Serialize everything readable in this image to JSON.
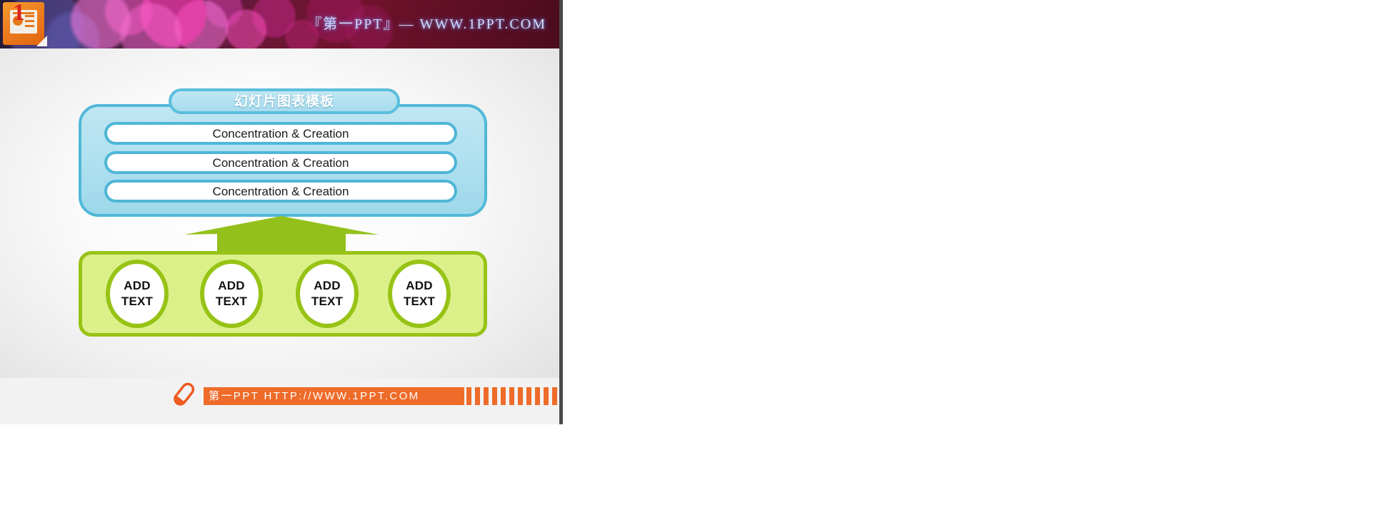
{
  "header": {
    "logo_icon": "ppt-file-icon",
    "logo_number": "1",
    "brand_text": "『第一PPT』— WWW.1PPT.COM"
  },
  "diagram": {
    "title": "幻灯片图表模板",
    "blue_rows": [
      {
        "label": "Concentration & Creation"
      },
      {
        "label": "Concentration & Creation"
      },
      {
        "label": "Concentration & Creation"
      }
    ],
    "arrow_icon": "up-arrow-icon",
    "circles": [
      {
        "line1": "ADD",
        "line2": "TEXT"
      },
      {
        "line1": "ADD",
        "line2": "TEXT"
      },
      {
        "line1": "ADD",
        "line2": "TEXT"
      },
      {
        "line1": "ADD",
        "line2": "TEXT"
      }
    ]
  },
  "footer": {
    "pen_icon": "pen-icon",
    "band_text": "第一PPT HTTP://WWW.1PPT.COM",
    "stripe_count": 12
  },
  "colors": {
    "blue_border": "#51b8d8",
    "blue_fill": "#aee0ef",
    "green_border": "#97c316",
    "green_fill": "#dcf08a",
    "orange": "#ee6b29",
    "header_dark": "#5a1f46"
  }
}
